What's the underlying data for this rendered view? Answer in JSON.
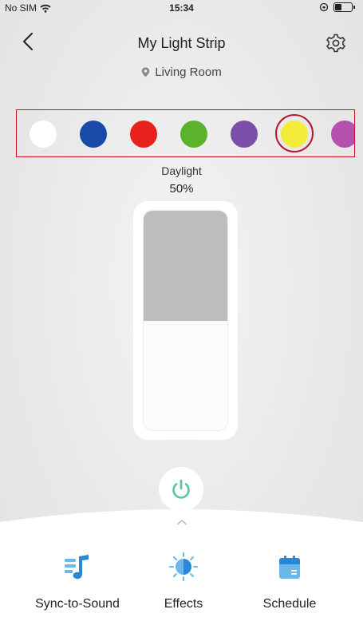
{
  "status_bar": {
    "carrier": "No SIM",
    "time": "15:34"
  },
  "header": {
    "title": "My Light Strip",
    "location": "Living Room"
  },
  "colors": {
    "swatches": [
      {
        "color": "#ffffff",
        "selected": false
      },
      {
        "color": "#1a4aa8",
        "selected": false
      },
      {
        "color": "#e8211d",
        "selected": false
      },
      {
        "color": "#5bb32d",
        "selected": false
      },
      {
        "color": "#7b4ea8",
        "selected": false
      },
      {
        "color": "#f4ec3a",
        "selected": true
      },
      {
        "color": "#b552b0",
        "selected": false
      }
    ]
  },
  "current": {
    "preset_name": "Daylight",
    "brightness_label": "50%",
    "brightness": 0.5
  },
  "accent_color": "#5cc49c",
  "tabs": [
    {
      "label": "Sync-to-Sound",
      "icon": "music-note-icon"
    },
    {
      "label": "Effects",
      "icon": "effects-icon"
    },
    {
      "label": "Schedule",
      "icon": "calendar-icon"
    }
  ]
}
